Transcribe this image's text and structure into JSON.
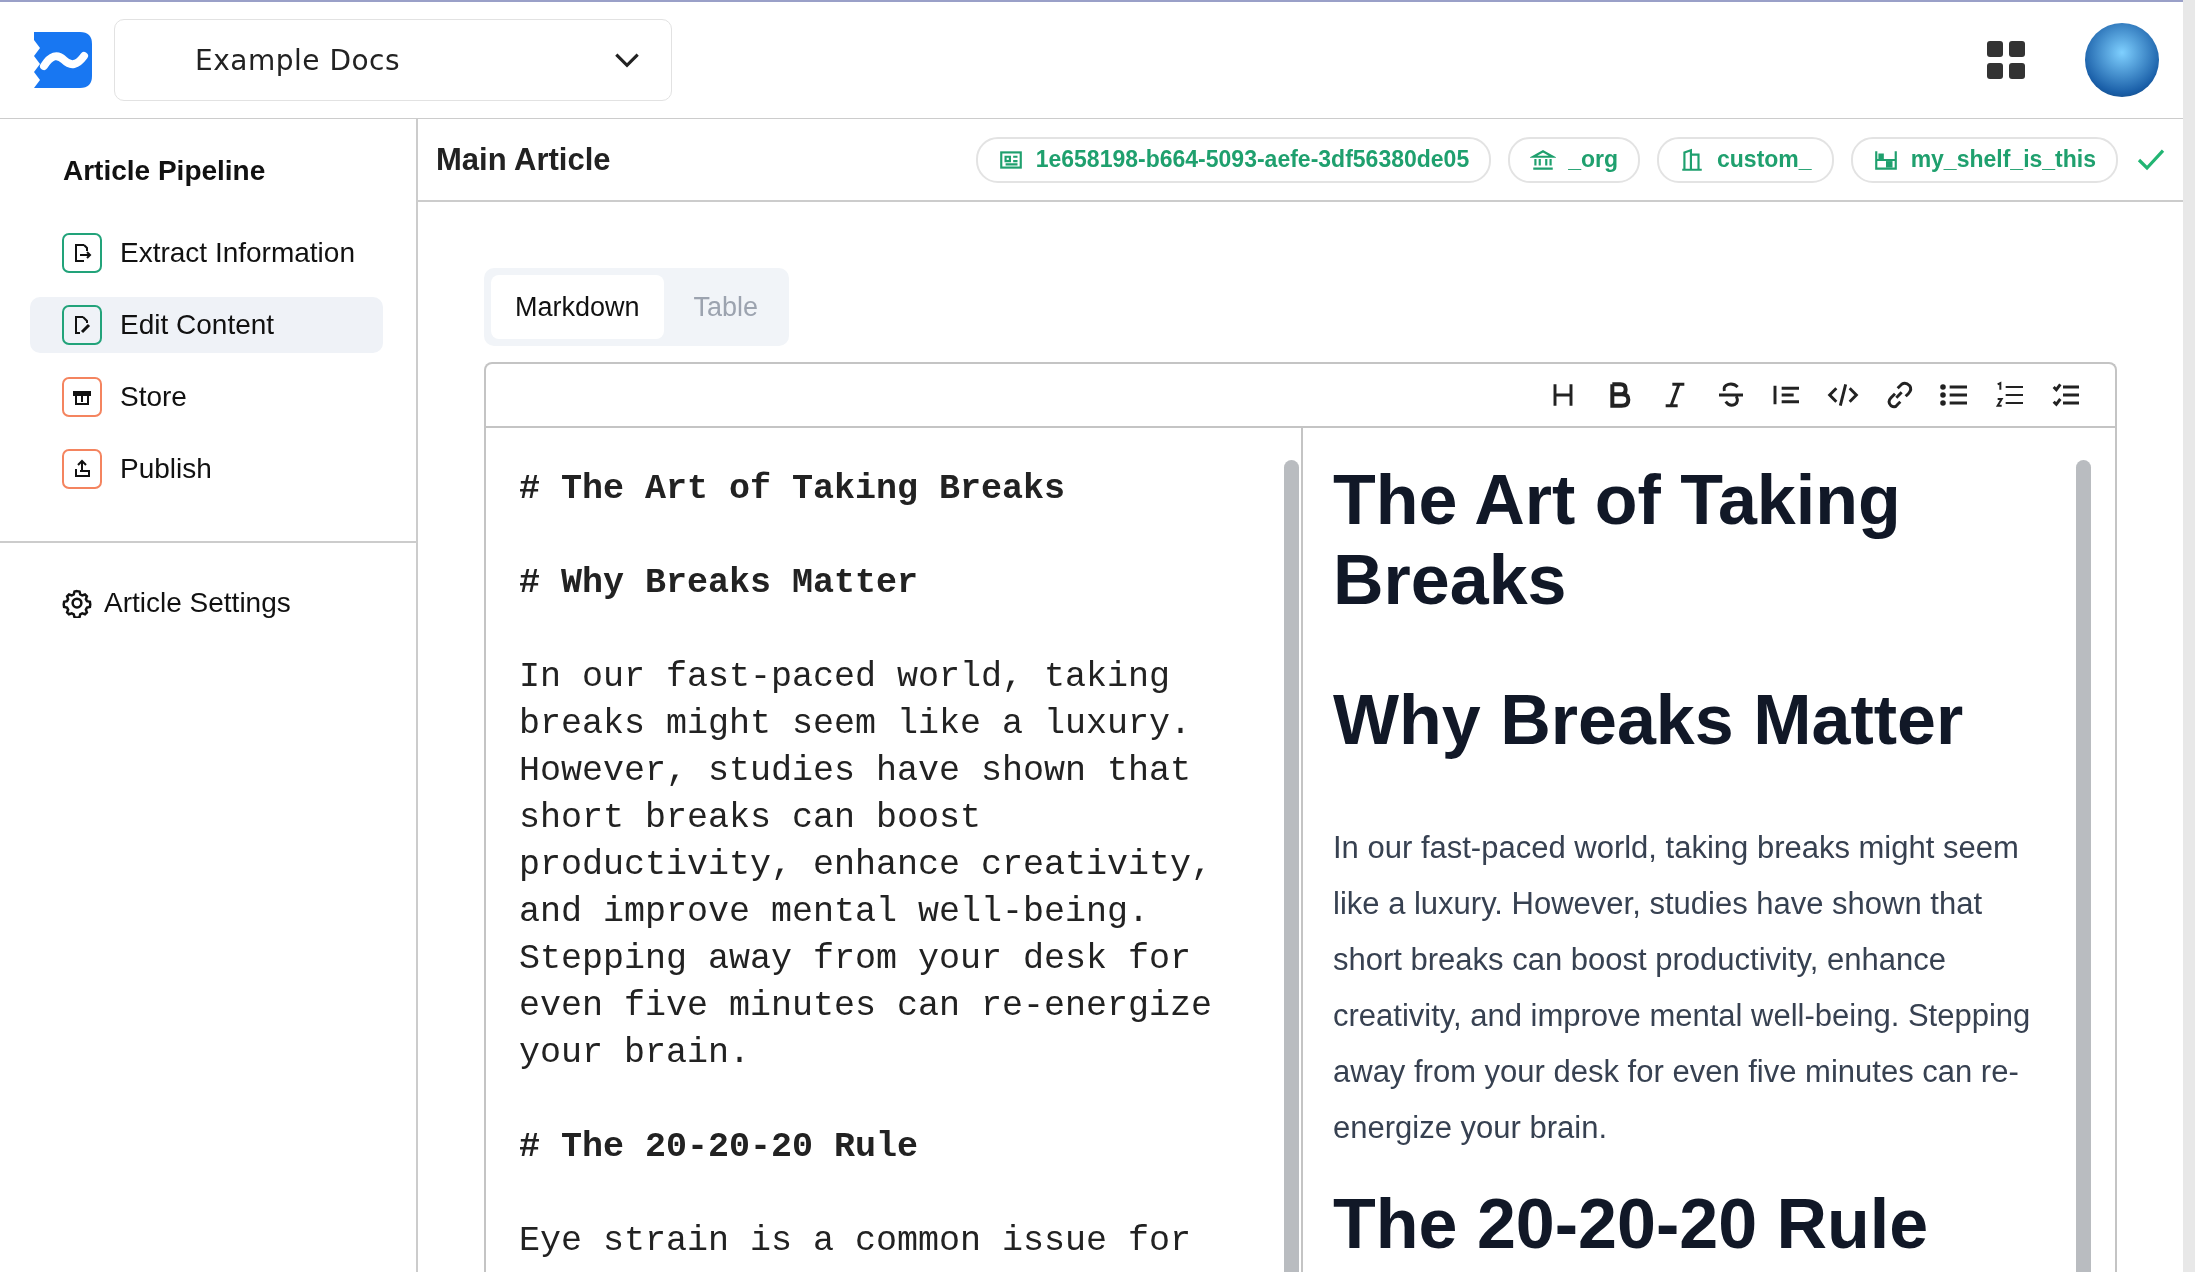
{
  "header": {
    "workspace": "Example Docs"
  },
  "sidebar": {
    "title": "Article Pipeline",
    "items": [
      {
        "label": "Extract Information",
        "selected": false,
        "color": "#22a37a"
      },
      {
        "label": "Edit Content",
        "selected": true,
        "color": "#22a37a"
      },
      {
        "label": "Store",
        "selected": false,
        "color": "#f4845f"
      },
      {
        "label": "Publish",
        "selected": false,
        "color": "#f4845f"
      }
    ],
    "settings": "Article Settings"
  },
  "article": {
    "title": "Main Article",
    "badges": [
      "1e658198-b664-5093-aefe-3df56380de05",
      "_org",
      "custom_",
      "my_shelf_is_this"
    ],
    "saved": true
  },
  "tabs": [
    {
      "label": "Markdown",
      "selected": true
    },
    {
      "label": "Table",
      "selected": false
    }
  ],
  "markdown": [
    {
      "kind": "heading",
      "text": "# The Art of Taking Breaks"
    },
    {
      "kind": "heading",
      "text": "# Why Breaks Matter"
    },
    {
      "kind": "paragraph",
      "text": "In our fast-paced world, taking breaks might seem like a luxury. However, studies have shown that short breaks can boost productivity, enhance creativity, and improve mental well-being. Stepping away from your desk for even five minutes can re-energize your brain."
    },
    {
      "kind": "heading",
      "text": "# The 20-20-20 Rule"
    },
    {
      "kind": "paragraph",
      "text": "Eye strain is a common issue for"
    }
  ],
  "preview": [
    {
      "kind": "heading",
      "text": "The Art of Taking Breaks"
    },
    {
      "kind": "heading",
      "text": "Why Breaks Matter"
    },
    {
      "kind": "paragraph",
      "text": "In our fast-paced world, taking breaks might seem like a luxury. However, studies have shown that short breaks can boost productivity, enhance creativity, and improve mental well-being. Stepping away from your desk for even five minutes can re-energize your brain."
    },
    {
      "kind": "heading",
      "text": "The 20-20-20 Rule"
    }
  ]
}
